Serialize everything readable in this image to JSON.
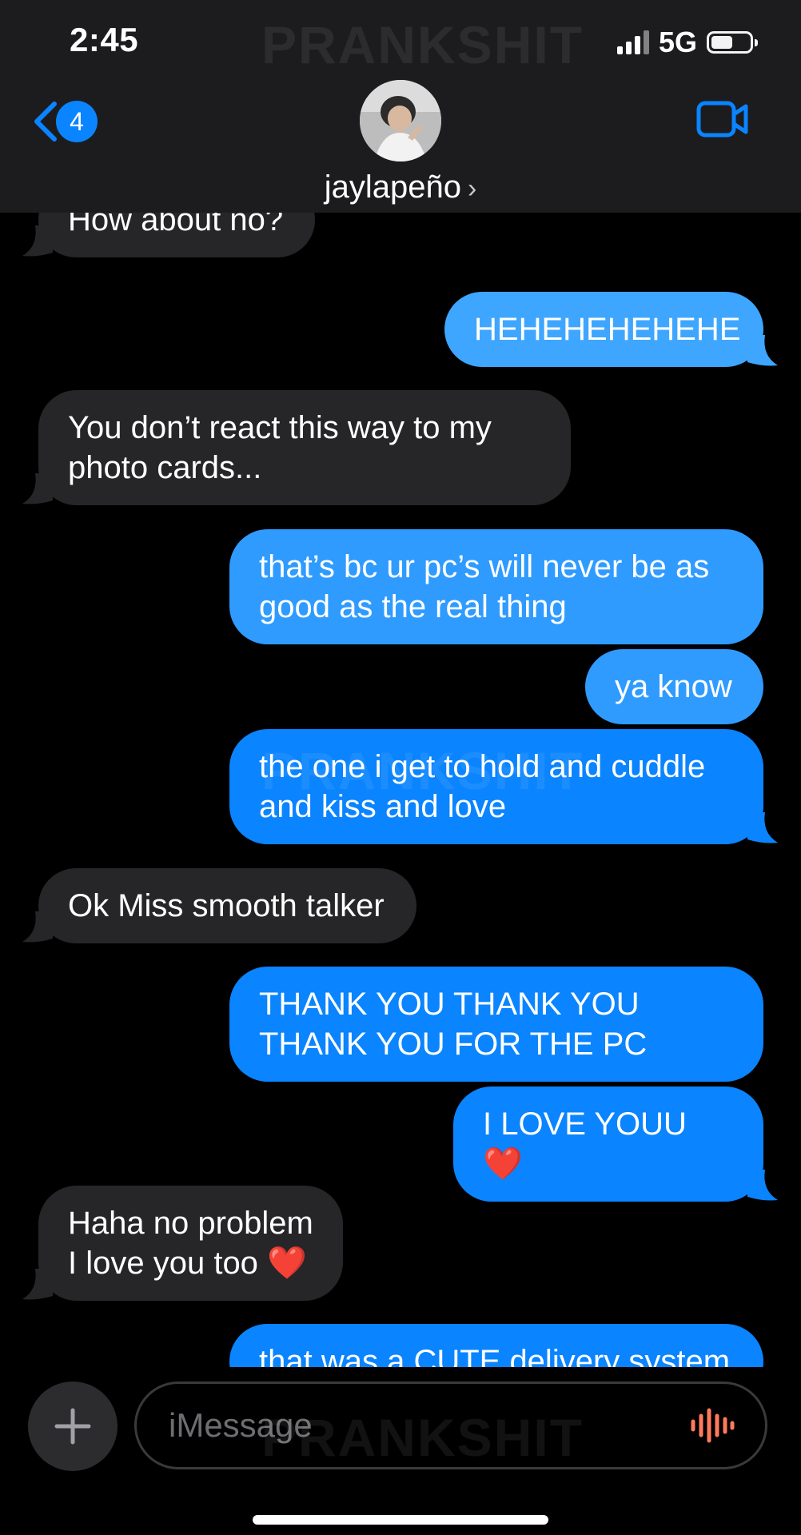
{
  "status": {
    "time": "2:45",
    "network": "5G"
  },
  "header": {
    "back_count": "4",
    "contact_name": "jaylapeño"
  },
  "watermark": "PRANKSHIT",
  "messages": [
    {
      "dir": "in",
      "text": "How about  no?"
    },
    {
      "dir": "out",
      "text": "HEHEHEHEHEHE"
    },
    {
      "dir": "in",
      "text": "You don’t react this way to my photo cards..."
    },
    {
      "dir": "out",
      "text": "that’s bc ur pc’s will never be as good as  the real thing"
    },
    {
      "dir": "out",
      "text": "ya know"
    },
    {
      "dir": "out",
      "text": "the one i get to hold and cuddle and kiss and  love"
    },
    {
      "dir": "in",
      "text": "Ok Miss smooth talker"
    },
    {
      "dir": "out",
      "text": "THANK YOU THANK YOU THANK YOU FOR THE PC"
    },
    {
      "dir": "out",
      "text": "I LOVE YOUU ❤️"
    },
    {
      "dir": "in",
      "text": "Haha no problem I love you too ❤️"
    },
    {
      "dir": "out",
      "text": "that was a CUTE delivery system"
    }
  ],
  "composer": {
    "placeholder": "iMessage"
  },
  "colors": {
    "accent": "#0a84ff",
    "incoming": "#262628",
    "header_bg": "#1c1c1e",
    "mic": "#ff7a5c"
  }
}
